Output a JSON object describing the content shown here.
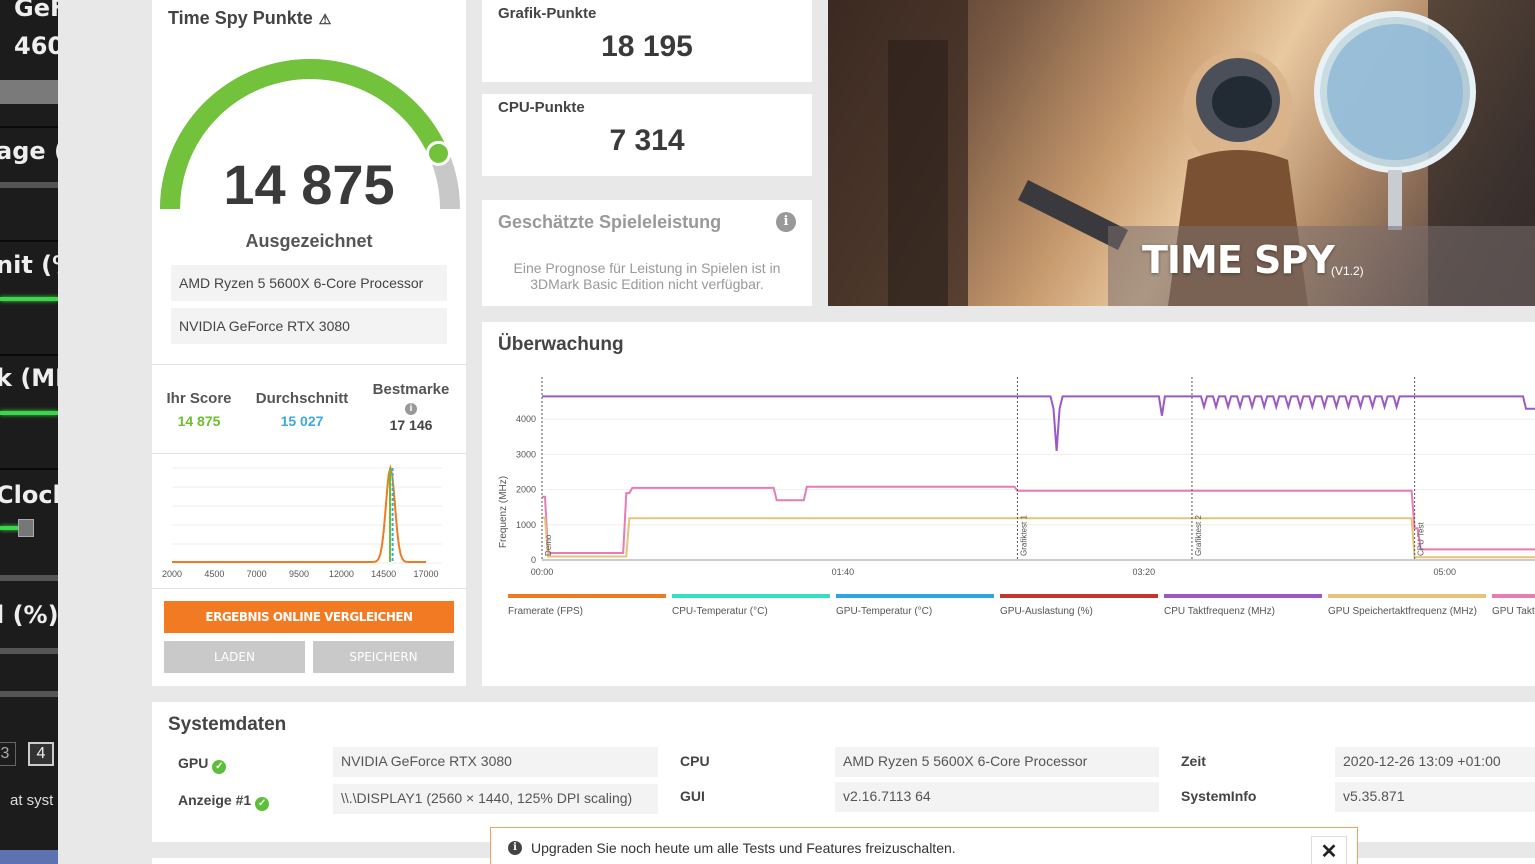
{
  "left_overlay": {
    "labels": [
      "GeF",
      "460",
      "age (%",
      "nit (%",
      "k (MH",
      "Clock",
      "l (%)",
      "at syst"
    ],
    "tabs": [
      "3",
      "4"
    ]
  },
  "score": {
    "title": "Time Spy Punkte",
    "value": "14 875",
    "rating": "Ausgezeichnet",
    "gauge_fraction": 0.87,
    "cpu": "AMD Ryzen 5 5600X 6-Core Processor",
    "gpu": "NVIDIA GeForce RTX 3080",
    "your_score_label": "Ihr Score",
    "your_score": "14 875",
    "average_label": "Durchschnitt",
    "average": "15 027",
    "best_label": "Bestmarke",
    "best": "17 146",
    "compare_button": "ERGEBNIS ONLINE VERGLEICHEN",
    "load_button": "LADEN",
    "save_button": "SPEICHERN",
    "histogram_ticks": [
      "2000",
      "4500",
      "7000",
      "9500",
      "12000",
      "14500",
      "17000"
    ]
  },
  "graphics": {
    "label": "Grafik-Punkte",
    "value": "18 195"
  },
  "cpu_points": {
    "label": "CPU-Punkte",
    "value": "7 314"
  },
  "estimate": {
    "title": "Geschätzte Spieleleistung",
    "text": "Eine Prognose für Leistung in Spielen ist in 3DMark Basic Edition nicht verfügbar."
  },
  "banner": {
    "title": "TIME SPY",
    "version": "(V1.2)"
  },
  "monitoring": {
    "title": "Überwachung",
    "ylabel": "Frequenz (MHz)",
    "yticks": [
      "4000",
      "3000",
      "2000",
      "1000",
      "0"
    ],
    "xticks": [
      "00:00",
      "01:40",
      "03:20",
      "05:00"
    ],
    "markers": [
      "Demo",
      "Grafiktest 1",
      "Grafiktest 2",
      "CPU Test"
    ],
    "legend": [
      {
        "label": "Framerate (FPS)",
        "color": "#f07a22"
      },
      {
        "label": "CPU-Temperatur (°C)",
        "color": "#33e0c0"
      },
      {
        "label": "GPU-Temperatur (°C)",
        "color": "#2aa6e8"
      },
      {
        "label": "GPU-Auslastung (%)",
        "color": "#c8332e"
      },
      {
        "label": "CPU Taktfrequenz (MHz)",
        "color": "#9b59c8"
      },
      {
        "label": "GPU Speichertaktfrequenz (MHz)",
        "color": "#e8c27a"
      },
      {
        "label": "GPU Taktfr",
        "color": "#e87ab4"
      }
    ]
  },
  "system": {
    "title": "Systemdaten",
    "gpu_label": "GPU",
    "gpu": "NVIDIA GeForce RTX 3080",
    "display_label": "Anzeige #1",
    "display": "\\\\.\\DISPLAY1 (2560 × 1440, 125% DPI scaling)",
    "cpu_label": "CPU",
    "cpu": "AMD Ryzen 5 5600X 6-Core Processor",
    "gui_label": "GUI",
    "gui": "v2.16.7113 64",
    "time_label": "Zeit",
    "time": "2020-12-26 13:09 +01:00",
    "sysinfo_label": "SystemInfo",
    "sysinfo": "v5.35.871"
  },
  "notice": {
    "text": "Upgraden Sie noch heute um alle Tests und Features freizuschalten.",
    "close": "✕"
  }
}
